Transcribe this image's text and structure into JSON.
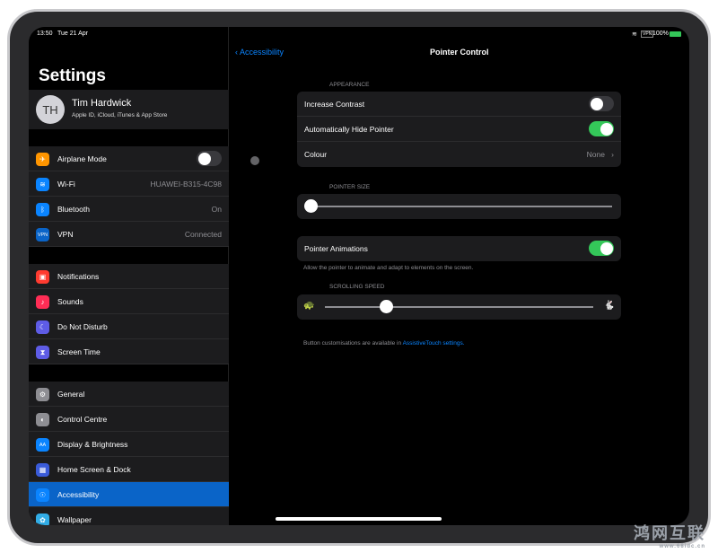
{
  "status": {
    "time": "13:50",
    "date": "Tue 21 Apr",
    "battery": "100%"
  },
  "sidebar": {
    "title": "Settings",
    "profile": {
      "initials": "TH",
      "name": "Tim Hardwick",
      "subtitle": "Apple ID, iCloud, iTunes & App Store"
    },
    "groups": [
      [
        {
          "label": "Airplane Mode",
          "icon": "airplane-icon",
          "color": "#ff9500",
          "glyph": "✈",
          "toggle": false
        },
        {
          "label": "Wi-Fi",
          "icon": "wifi-icon",
          "color": "#0a84ff",
          "glyph": "≋",
          "value": "HUAWEI-B315-4C98"
        },
        {
          "label": "Bluetooth",
          "icon": "bluetooth-icon",
          "color": "#0a84ff",
          "glyph": "ᛒ",
          "value": "On"
        },
        {
          "label": "VPN",
          "icon": "vpn-icon",
          "color": "#0a64c8",
          "glyph": "VPN",
          "value": "Connected"
        }
      ],
      [
        {
          "label": "Notifications",
          "icon": "notifications-icon",
          "color": "#ff3b30",
          "glyph": "▣"
        },
        {
          "label": "Sounds",
          "icon": "sounds-icon",
          "color": "#ff2d55",
          "glyph": "♪"
        },
        {
          "label": "Do Not Disturb",
          "icon": "moon-icon",
          "color": "#5e5ce6",
          "glyph": "☾"
        },
        {
          "label": "Screen Time",
          "icon": "hourglass-icon",
          "color": "#5e5ce6",
          "glyph": "⧗"
        }
      ],
      [
        {
          "label": "General",
          "icon": "gear-icon",
          "color": "#8e8e93",
          "glyph": "⚙"
        },
        {
          "label": "Control Centre",
          "icon": "switches-icon",
          "color": "#8e8e93",
          "glyph": "◐"
        },
        {
          "label": "Display & Brightness",
          "icon": "display-icon",
          "color": "#0a84ff",
          "glyph": "AA"
        },
        {
          "label": "Home Screen & Dock",
          "icon": "home-grid-icon",
          "color": "#3a5bd9",
          "glyph": "▦"
        },
        {
          "label": "Accessibility",
          "icon": "accessibility-icon",
          "color": "#0a84ff",
          "glyph": "☉",
          "selected": true
        },
        {
          "label": "Wallpaper",
          "icon": "wallpaper-icon",
          "color": "#32ade6",
          "glyph": "✿"
        }
      ]
    ]
  },
  "detail": {
    "back": "Accessibility",
    "title": "Pointer Control",
    "appearance_header": "APPEARANCE",
    "increase_contrast": {
      "label": "Increase Contrast",
      "on": false
    },
    "auto_hide": {
      "label": "Automatically Hide Pointer",
      "on": true
    },
    "colour": {
      "label": "Colour",
      "value": "None"
    },
    "pointer_size_header": "POINTER SIZE",
    "pointer_size": 0,
    "animations": {
      "label": "Pointer Animations",
      "on": true
    },
    "animations_note": "Allow the pointer to animate and adapt to elements on the screen.",
    "scrolling_header": "SCROLLING SPEED",
    "scrolling_speed": 0.24,
    "footer_text": "Button customisations are available in ",
    "footer_link": "AssistiveTouch settings."
  },
  "watermark": {
    "text": "鸿网互联",
    "url": "www.68idc.cn"
  }
}
